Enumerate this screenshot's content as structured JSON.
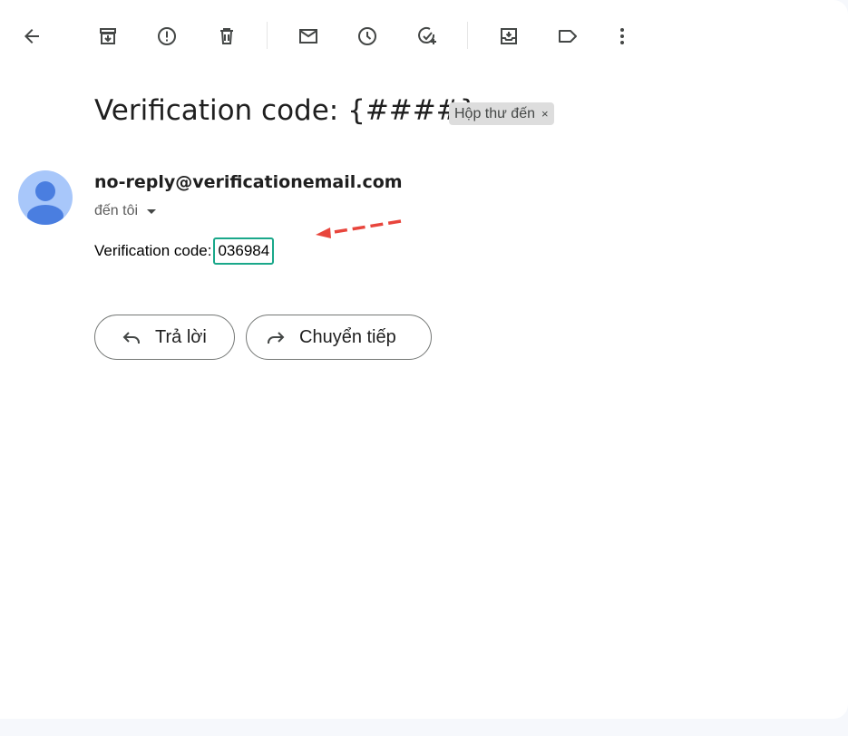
{
  "toolbar": {
    "back": "back-arrow-icon",
    "archive": "archive-icon",
    "report_spam": "report-spam-icon",
    "delete": "trash-icon",
    "mark_unread": "mail-icon",
    "snooze": "clock-icon",
    "add_task": "add-task-icon",
    "move_to": "move-to-inbox-icon",
    "label": "label-icon",
    "more": "more-vert-icon"
  },
  "email": {
    "subject": "Verification code: {####}",
    "label_chip": "Hộp thư đến",
    "label_chip_close": "×",
    "sender": "no-reply@verificationemail.com",
    "to": "đến tôi",
    "body_prefix": "Verification code:",
    "code": "036984"
  },
  "actions": {
    "reply": "Trả lời",
    "forward": "Chuyển tiếp"
  },
  "colors": {
    "code_highlight": "#1aa88a",
    "annotation_arrow": "#e8453c",
    "avatar_bg": "#a8c7fa",
    "avatar_fg": "#4a7ee0"
  }
}
